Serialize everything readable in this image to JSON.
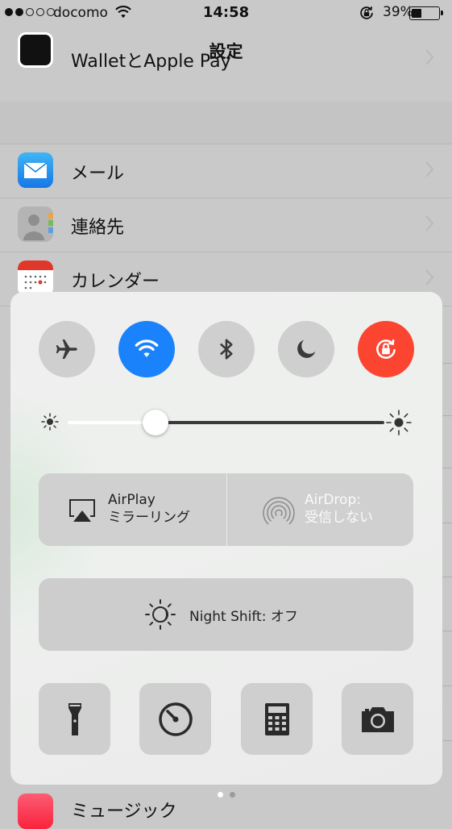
{
  "status_bar": {
    "signal_dots": [
      true,
      true,
      false,
      false,
      false
    ],
    "carrier": "docomo",
    "time": "14:58",
    "battery_percent": "39%",
    "battery_level": 0.39,
    "icons": [
      "wifi-icon",
      "rotation-lock-icon",
      "battery-icon"
    ]
  },
  "settings": {
    "title": "設定",
    "rows": [
      {
        "label": "WalletとApple Pay",
        "icon": "wallet-icon"
      },
      {
        "label": "メール",
        "icon": "mail-icon"
      },
      {
        "label": "連絡先",
        "icon": "contacts-icon"
      },
      {
        "label": "カレンダー",
        "icon": "calendar-icon"
      },
      {
        "label": "ミュージック",
        "icon": "music-icon"
      }
    ]
  },
  "control_center": {
    "toggles": [
      {
        "name": "airplane-mode",
        "icon": "airplane-icon",
        "active": false
      },
      {
        "name": "wifi",
        "icon": "wifi-icon",
        "active": true,
        "color": "#1a82fb"
      },
      {
        "name": "bluetooth",
        "icon": "bluetooth-icon",
        "active": false
      },
      {
        "name": "do-not-disturb",
        "icon": "moon-icon",
        "active": false
      },
      {
        "name": "rotation-lock",
        "icon": "rotation-lock-icon",
        "active": true,
        "color": "#fb4531"
      }
    ],
    "brightness_level": 0.28,
    "airplay": {
      "line1": "AirPlay",
      "line2": "ミラーリング"
    },
    "airdrop": {
      "line1": "AirDrop:",
      "line2": "受信しない"
    },
    "night_shift": {
      "label": "Night Shift: オフ"
    },
    "tools": [
      {
        "name": "flashlight",
        "icon": "flashlight-icon"
      },
      {
        "name": "timer",
        "icon": "timer-icon"
      },
      {
        "name": "calculator",
        "icon": "calculator-icon"
      },
      {
        "name": "camera",
        "icon": "camera-icon"
      }
    ],
    "page_count": 2,
    "current_page": 1
  }
}
